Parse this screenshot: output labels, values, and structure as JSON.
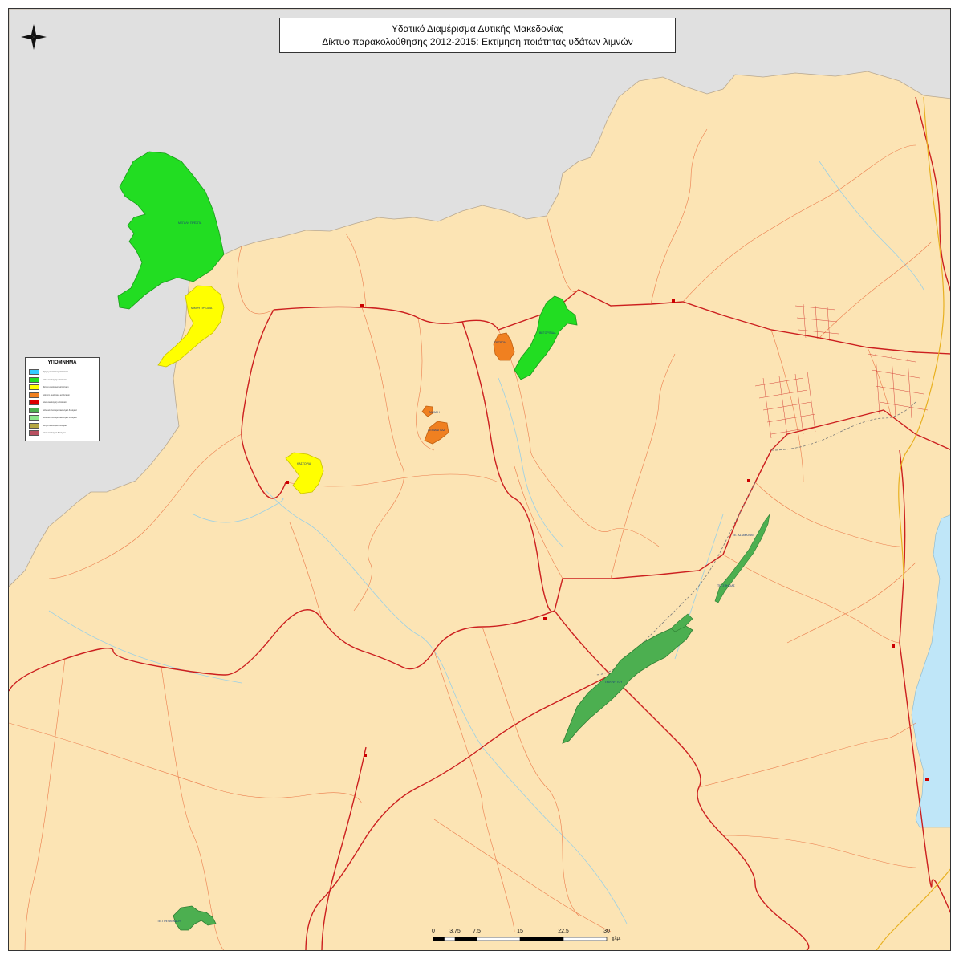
{
  "title": {
    "line1": "Υδατικό Διαμέρισμα Δυτικής Μακεδονίας",
    "line2": "Δίκτυο παρακολούθησης 2012-2015: Εκτίμηση ποιότητας υδάτων λιμνών"
  },
  "legend": {
    "title": "ΥΠΟΜΝΗΜΑ",
    "items": [
      {
        "label": "Υψηλή οικολογική κατάσταση",
        "color": "#33ccff"
      },
      {
        "label": "Καλή οικολογική κατάσταση",
        "color": "#22dd22"
      },
      {
        "label": "Μέτρια οικολογική κατάσταση",
        "color": "#ffff00"
      },
      {
        "label": "Ελλιπής οικολογική κατάσταση",
        "color": "#f08020"
      },
      {
        "label": "Κακή οικολογική κατάσταση",
        "color": "#dd0000"
      },
      {
        "label": "Καλό και ανώτερο οικολογικό δυναμικό",
        "color": "#4caf50"
      },
      {
        "label": "Καλό και ανώτερο οικολογικό δυναμικό",
        "color": "#8ce68c"
      },
      {
        "label": "Μέτριο οικολογικό δυναμικό",
        "color": "#b5a642"
      },
      {
        "label": "Κακό οικολογικό δυναμικό",
        "color": "#b85060"
      }
    ]
  },
  "scale": {
    "ticks": [
      "0",
      "3.75",
      "7.5",
      "15",
      "22.5",
      "30"
    ],
    "unit": "χλμ."
  },
  "colors": {
    "land": "#fce4b4",
    "outside": "#e0e0e0",
    "sea": "#bfe6f8",
    "road": "#cc1f1f",
    "minor_road": "#e86a3a",
    "river": "#9ad0e6"
  },
  "lakes": [
    {
      "name": "ΜΕΓΑΛΗ ΠΡΕΣΠΑ",
      "status": "good",
      "color": "#22dd22"
    },
    {
      "name": "ΜΙΚΡΗ ΠΡΕΣΠΑ",
      "status": "moderate",
      "color": "#ffff00"
    },
    {
      "name": "ΚΑΣΤΟΡΙΑ",
      "status": "moderate",
      "color": "#ffff00"
    },
    {
      "name": "ΒΕΓΟΡΙΤΙΔΑ",
      "status": "good",
      "color": "#22dd22"
    },
    {
      "name": "ΠΕΤΡΩΝ",
      "status": "poor",
      "color": "#f08020"
    },
    {
      "name": "ΖΑΖΑΡΗ",
      "status": "poor",
      "color": "#f08020"
    },
    {
      "name": "ΧΕΙΜΑΔΙΤΙΔΑ",
      "status": "poor",
      "color": "#f08020"
    },
    {
      "name": "ΠΟΛΥΦΥΤΟΥ",
      "status": "good potential",
      "color": "#4caf50"
    },
    {
      "name": "ΤΕ. ΑΣΩΜΑΤΩΝ",
      "status": "good potential",
      "color": "#4caf50"
    },
    {
      "name": "ΤΕ. ΣΦΗΚΙΑΣ",
      "status": "good potential",
      "color": "#4caf50"
    },
    {
      "name": "ΤΕ. ΠΗΓΩΝ ΑΩΟΥ",
      "status": "good potential",
      "color": "#4caf50"
    }
  ]
}
